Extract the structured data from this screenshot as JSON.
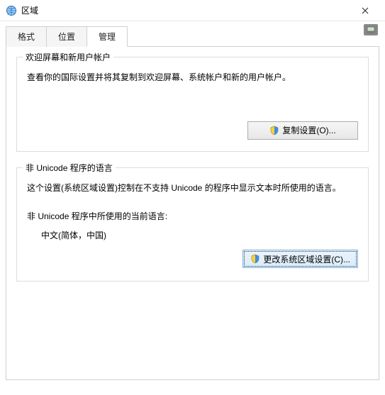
{
  "window": {
    "title": "区域"
  },
  "tabs": [
    {
      "label": "格式"
    },
    {
      "label": "位置"
    },
    {
      "label": "管理",
      "active": true
    }
  ],
  "group1": {
    "title": "欢迎屏幕和新用户帐户",
    "desc": "查看你的国际设置并将其复制到欢迎屏幕、系统帐户和新的用户帐户。",
    "button": "复制设置(O)..."
  },
  "group2": {
    "title": "非 Unicode 程序的语言",
    "desc": "这个设置(系统区域设置)控制在不支持 Unicode 的程序中显示文本时所使用的语言。",
    "current_label": "非 Unicode 程序中所使用的当前语言:",
    "current_value": "中文(简体，中国)",
    "button": "更改系统区域设置(C)..."
  },
  "icons": {
    "globe": "globe-icon",
    "close": "close-icon",
    "shield": "shield-icon",
    "help": "help-icon"
  }
}
